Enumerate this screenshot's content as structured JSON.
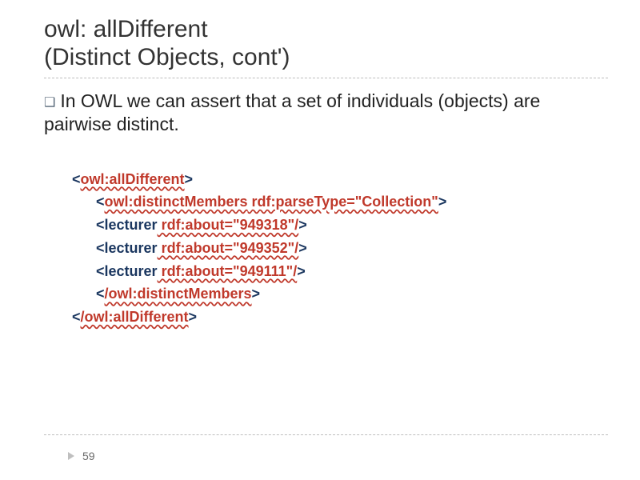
{
  "title_line1": "owl: allDifferent",
  "title_line2": "(Distinct Objects, cont')",
  "bullet_text": "In OWL we can assert that a set of individuals (objects) are pairwise distinct.",
  "code": {
    "open_alldiff_lt": "<",
    "open_alldiff_tag": "owl:allDifferent",
    "open_alldiff_gt": ">",
    "open_members_lt": "<",
    "open_members_tag": "owl:distinctMembers",
    "open_members_attr": " rdf:parseType=\"Collection\"",
    "open_members_gt": ">",
    "lect1_lt": "<",
    "lect1_tag": "lecturer",
    "lect1_attr": " rdf:about=\"949318\"/",
    "lect1_gt": ">",
    "lect2_lt": "<",
    "lect2_tag": "lecturer",
    "lect2_attr": " rdf:about=\"949352\"/",
    "lect2_gt": ">",
    "lect3_lt": "<",
    "lect3_tag": "lecturer",
    "lect3_attr": " rdf:about=\"949111\"/",
    "lect3_gt": ">",
    "close_members_lt": "<",
    "close_members_tag": "/owl:distinctMembers",
    "close_members_gt": ">",
    "close_alldiff_lt": "<",
    "close_alldiff_tag": "/owl:allDifferent",
    "close_alldiff_gt": ">"
  },
  "page_number": "59"
}
